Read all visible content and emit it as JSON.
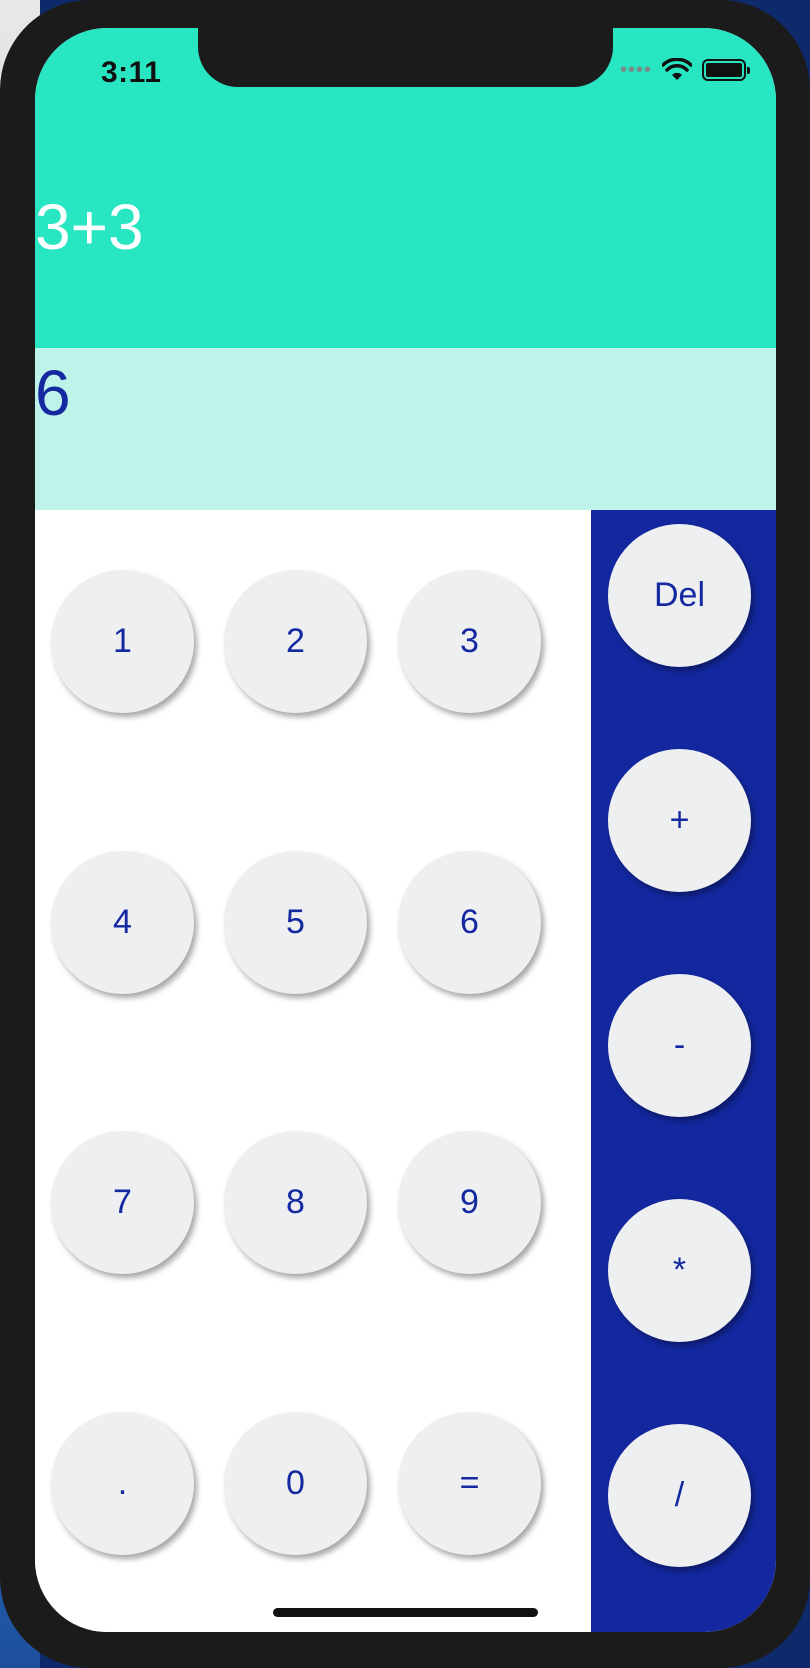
{
  "status_bar": {
    "time": "3:11",
    "signal_icon": "signal-dots-icon",
    "wifi_icon": "wifi-icon",
    "battery_icon": "battery-icon"
  },
  "display": {
    "expression": "3+3",
    "result": "6"
  },
  "keypad": {
    "digits": [
      [
        "1",
        "2",
        "3"
      ],
      [
        "4",
        "5",
        "6"
      ],
      [
        "7",
        "8",
        "9"
      ],
      [
        ".",
        "0",
        "="
      ]
    ]
  },
  "operators": [
    "Del",
    "+",
    "-",
    "*",
    "/"
  ],
  "colors": {
    "expression_bg": "#29e6c3",
    "result_bg": "#bdf3e8",
    "operator_panel_bg": "#13289f",
    "key_bg": "#eeeff1",
    "key_text": "#1428a0"
  }
}
